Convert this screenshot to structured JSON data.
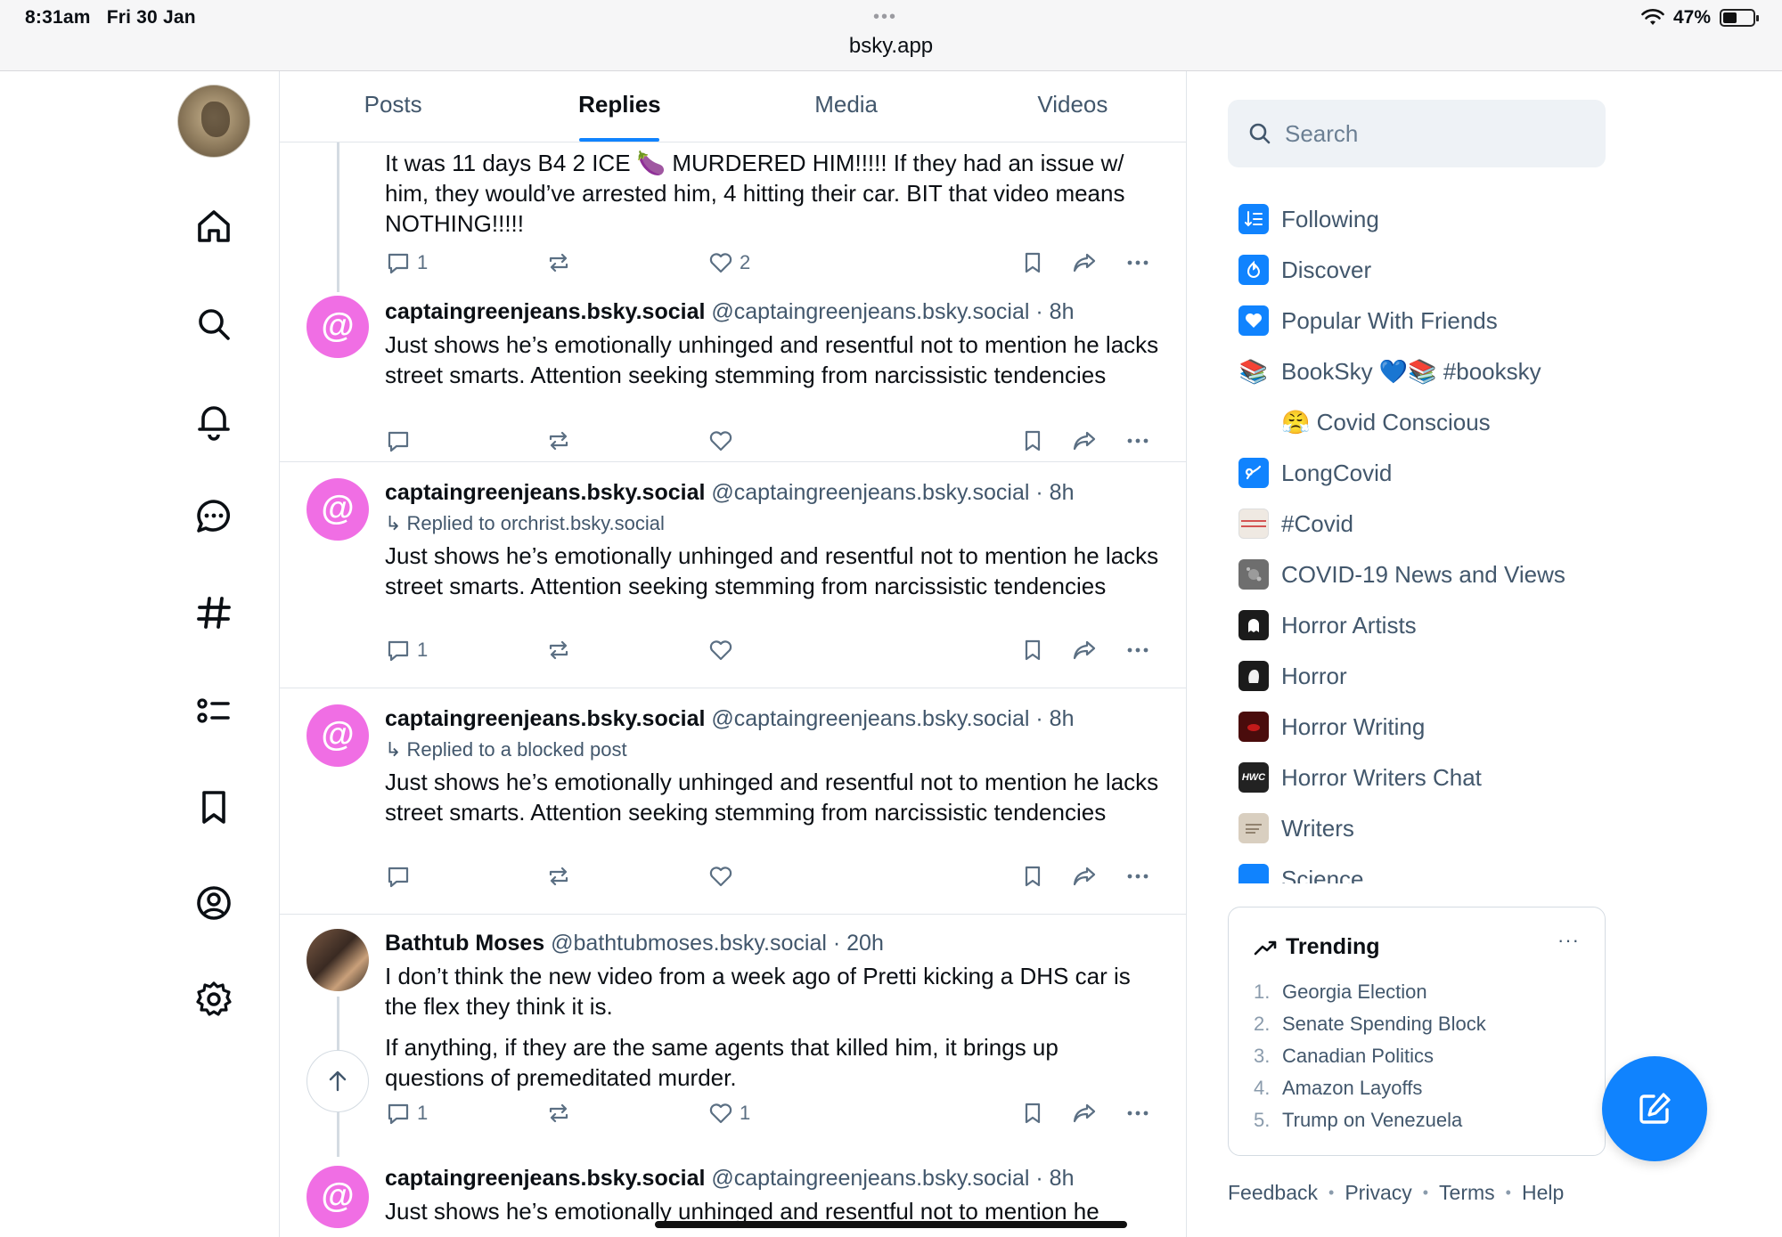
{
  "status_bar": {
    "time": "8:31am",
    "date": "Fri 30 Jan",
    "url": "bsky.app",
    "battery": "47%",
    "battery_level": 0.47
  },
  "tabs": [
    {
      "label": "Posts"
    },
    {
      "label": "Replies",
      "active": true
    },
    {
      "label": "Media"
    },
    {
      "label": "Videos"
    }
  ],
  "posts": [
    {
      "body": "It was 11 days B4  2 ICE 🍆 MURDERED HIM!!!!! If they had an issue w/ him, they would’ve arrested him, 4 hitting their car. BIT that video means NOTHING!!!!!",
      "reply_count": "1",
      "like_count": "2"
    },
    {
      "name": "captaingreenjeans.bsky.social",
      "handle": "@captaingreenjeans.bsky.social · 8h",
      "avatar_glyph": "@",
      "body": "Just shows he’s emotionally unhinged and resentful not to mention he lacks street smarts. Attention seeking stemming from narcissistic tendencies",
      "reply_count": "",
      "like_count": ""
    },
    {
      "name": "captaingreenjeans.bsky.social",
      "handle": "@captaingreenjeans.bsky.social · 8h",
      "avatar_glyph": "@",
      "reply_to": "↳ Replied to orchrist.bsky.social",
      "body": "Just shows he’s emotionally unhinged and resentful not to mention he lacks street smarts. Attention seeking stemming from narcissistic tendencies",
      "reply_count": "1",
      "like_count": ""
    },
    {
      "name": "captaingreenjeans.bsky.social",
      "handle": "@captaingreenjeans.bsky.social · 8h",
      "avatar_glyph": "@",
      "reply_to": "↳ Replied to a blocked post",
      "body": "Just shows he’s emotionally unhinged and resentful not to mention he lacks street smarts. Attention seeking stemming from narcissistic tendencies",
      "reply_count": "",
      "like_count": ""
    },
    {
      "name": "Bathtub Moses",
      "handle": "@bathtubmoses.bsky.social · 20h",
      "body_1": "I don’t think the new video from a week ago of Pretti kicking a DHS car is the flex they think it is.",
      "body_2": "If anything, if they are the same agents that killed him, it brings up questions of premeditated murder.",
      "reply_count": "1",
      "like_count": "1"
    },
    {
      "name": "captaingreenjeans.bsky.social",
      "handle": "@captaingreenjeans.bsky.social · 8h",
      "avatar_glyph": "@",
      "body": "Just shows he’s emotionally unhinged and resentful not to mention he"
    }
  ],
  "search": {
    "placeholder": "Search"
  },
  "feeds": [
    {
      "label": "Following",
      "icon": "following-icon",
      "color": "#1083fe"
    },
    {
      "label": "Discover",
      "icon": "discover-icon",
      "color": "#1083fe"
    },
    {
      "label": "Popular With Friends",
      "icon": "heart-icon",
      "color": "#1083fe"
    },
    {
      "label": "BookSky 💙📚 #booksky",
      "icon": "books-icon",
      "emoji": "📚"
    },
    {
      "label": "😤 Covid Conscious",
      "icon": "mask-icon",
      "emoji": "😷"
    },
    {
      "label": "LongCovid",
      "icon": "longcovid-icon",
      "color": "#1083fe"
    },
    {
      "label": "#Covid",
      "icon": "covid-icon",
      "color": "#e8e3dc"
    },
    {
      "label": "COVID-19 News and Views",
      "icon": "virus-icon",
      "color": "#6e6e6e"
    },
    {
      "label": "Horror Artists",
      "icon": "ghost-icon",
      "color": "#1b1b1b"
    },
    {
      "label": "Horror",
      "icon": "ghost-icon",
      "color": "#1b1b1b"
    },
    {
      "label": "Horror Writing",
      "icon": "horror-writing-icon",
      "color": "#4a0c0c"
    },
    {
      "label": "Horror Writers Chat",
      "icon": "hwc-icon",
      "color": "#222222"
    },
    {
      "label": "Writers",
      "icon": "writers-icon",
      "color": "#d9cfc0"
    },
    {
      "label": "Science",
      "icon": "science-icon",
      "color": "#1083fe"
    }
  ],
  "trending": {
    "title": "Trending",
    "more": "···",
    "items": [
      {
        "num": "1.",
        "label": "Georgia Election"
      },
      {
        "num": "2.",
        "label": "Senate Spending Block"
      },
      {
        "num": "3.",
        "label": "Canadian Politics"
      },
      {
        "num": "4.",
        "label": "Amazon Layoffs"
      },
      {
        "num": "5.",
        "label": "Trump on Venezuela"
      }
    ]
  },
  "footer": {
    "feedback": "Feedback",
    "privacy": "Privacy",
    "terms": "Terms",
    "help": "Help",
    "separator": "•"
  },
  "colors": {
    "accent": "#1083fe",
    "avatar_pink": "#f06ee4",
    "muted": "#42576c",
    "border": "#e1e5ea"
  }
}
